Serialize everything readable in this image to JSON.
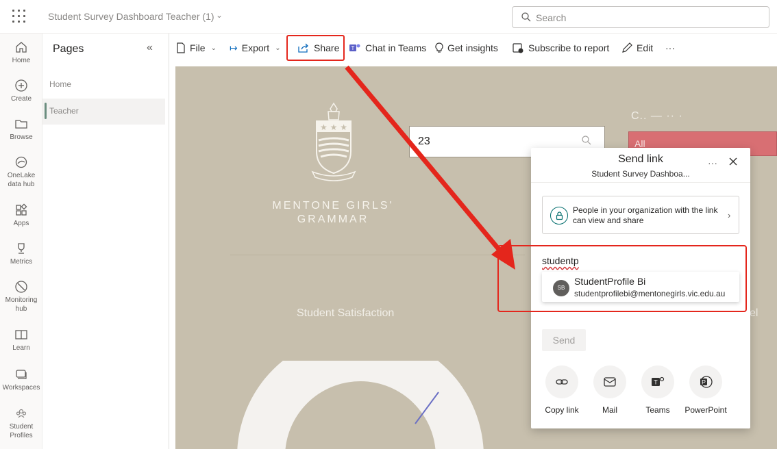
{
  "header": {
    "title": "Student Survey Dashboard Teacher (1)",
    "search_placeholder": "Search"
  },
  "rail": {
    "home": "Home",
    "create": "Create",
    "browse": "Browse",
    "onelake": "OneLake data hub",
    "apps": "Apps",
    "metrics": "Metrics",
    "monitoring": "Monitoring hub",
    "learn": "Learn",
    "workspaces": "Workspaces",
    "student_profiles": "Student Profiles"
  },
  "pages": {
    "title": "Pages",
    "items": [
      {
        "label": "Home"
      },
      {
        "label": "Teacher"
      }
    ]
  },
  "toolbar": {
    "file": "File",
    "export": "Export",
    "share": "Share",
    "chat": "Chat in Teams",
    "insights": "Get insights",
    "subscribe": "Subscribe to report",
    "edit": "Edit",
    "more": "···"
  },
  "canvas": {
    "school_line1": "MENTONE GIRLS'",
    "school_line2": "GRAMMAR",
    "slicer_value": "23",
    "pink_slicer_value": "All",
    "satisfaction_title": "Student Satisfaction",
    "right_fragment": "el"
  },
  "dialog": {
    "title": "Send link",
    "subtitle": "Student Survey Dashboa...",
    "more": "···",
    "permission_text": "People in your organization with the link can view and share",
    "input_value": "studentp",
    "suggestion": {
      "initials": "SB",
      "name": "StudentProfile Bi",
      "email": "studentprofilebi@mentonegirls.vic.edu.au"
    },
    "send_label": "Send",
    "options": {
      "copy": "Copy link",
      "mail": "Mail",
      "teams": "Teams",
      "powerpoint": "PowerPoint"
    }
  },
  "colors": {
    "canvas_bg": "#c7bfad",
    "annotation_red": "#e4261c",
    "slicer_pink": "#d86f73"
  }
}
